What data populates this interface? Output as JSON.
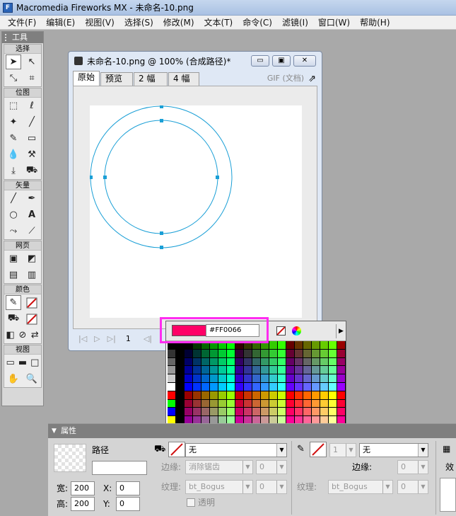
{
  "window": {
    "title": "Macromedia Fireworks MX - 未命名-10.png",
    "app_icon_text": "F"
  },
  "menu": [
    "文件(F)",
    "编辑(E)",
    "视图(V)",
    "选择(S)",
    "修改(M)",
    "文本(T)",
    "命令(C)",
    "滤镜(I)",
    "窗口(W)",
    "帮助(H)"
  ],
  "tools": {
    "title": "工具",
    "sections": {
      "select": "选择",
      "bitmap": "位图",
      "vector": "矢量",
      "web": "网页",
      "colors": "颜色",
      "view": "视图"
    }
  },
  "document": {
    "title": "未命名-10.png @  100% (合成路径)*",
    "tabs": [
      "原始",
      "预览",
      "2 幅",
      "4 幅"
    ],
    "active_tab": "原始",
    "export_info": "GIF (文档)",
    "frame_number": "1",
    "window_buttons": [
      "minimize",
      "maximize",
      "close"
    ]
  },
  "color_popup": {
    "hex": "#FF0066",
    "swatch_color": "#ff0066",
    "no_color_icon": "no-color-icon",
    "picker_icon": "color-wheel-icon"
  },
  "properties": {
    "title": "属性",
    "object_type": "路径",
    "object_name_value": "",
    "width_label": "宽:",
    "width": "200",
    "height_label": "高:",
    "height": "200",
    "x_label": "X:",
    "x": "0",
    "y_label": "Y:",
    "y": "0",
    "fill_value": "无",
    "edge_label": "边缘:",
    "edge_value": "消除锯齿",
    "edge_amount": "0",
    "texture_label": "纹理:",
    "texture_value": "bt_Bogus",
    "texture_amount": "0",
    "transparent_label": "透明",
    "stroke_size": "1",
    "stroke_value": "无",
    "stroke_edge_label": "边缘:",
    "stroke_edge_amount": "0",
    "stroke_texture_label": "纹理:",
    "stroke_texture_value": "bt_Bogus",
    "stroke_texture_amount": "0",
    "effects_label": "效"
  },
  "colors": {
    "highlight": "#ff2cf0",
    "path_blue": "#1a9fd6",
    "stroke_red": "#d01010"
  }
}
